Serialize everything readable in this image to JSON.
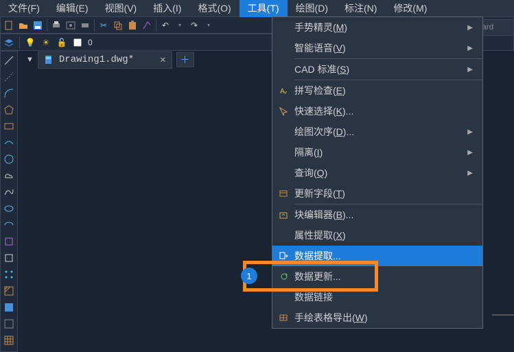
{
  "menubar": [
    {
      "label": "文件(F)",
      "active": false
    },
    {
      "label": "编辑(E)",
      "active": false
    },
    {
      "label": "视图(V)",
      "active": false
    },
    {
      "label": "插入(I)",
      "active": false
    },
    {
      "label": "格式(O)",
      "active": false
    },
    {
      "label": "工具(T)",
      "active": true
    },
    {
      "label": "绘图(D)",
      "active": false
    },
    {
      "label": "标注(N)",
      "active": false
    },
    {
      "label": "修改(M)",
      "active": false
    }
  ],
  "toolbar2": {
    "value": "0"
  },
  "tab": {
    "filename": "Drawing1.dwg*"
  },
  "rightFrag": "ard",
  "badge": "1",
  "dropdown": [
    {
      "label": "手势精灵",
      "key": "M",
      "submenu": true,
      "sep": false
    },
    {
      "label": "智能语音",
      "key": "V",
      "submenu": true,
      "sep": true
    },
    {
      "label": "CAD 标准",
      "key": "S",
      "submenu": true,
      "sep": true
    },
    {
      "label": "拼写检查",
      "key": "E",
      "icon": "spell",
      "sep": false
    },
    {
      "label": "快速选择",
      "key": "K",
      "ellipsis": true,
      "icon": "qselect",
      "sep": false
    },
    {
      "label": "绘图次序",
      "key": "D",
      "ellipsis": true,
      "submenu": true,
      "sep": false
    },
    {
      "label": "隔离",
      "key": "I",
      "submenu": true,
      "sep": false
    },
    {
      "label": "查询",
      "key": "Q",
      "submenu": true,
      "sep": false
    },
    {
      "label": "更新字段",
      "key": "T",
      "icon": "field",
      "sep": true
    },
    {
      "label": "块编辑器",
      "key": "B",
      "ellipsis": true,
      "icon": "block",
      "sep": false
    },
    {
      "label": "属性提取",
      "key": "X",
      "sep": false
    },
    {
      "label": "数据提取",
      "key": "",
      "ellipsis": true,
      "icon": "extract",
      "highlighted": true,
      "sep": false
    },
    {
      "label": "数据更新",
      "key": "",
      "ellipsis": true,
      "icon": "refresh",
      "sep": false
    },
    {
      "label": "数据链接",
      "key": "",
      "sep": false
    },
    {
      "label": "手绘表格导出",
      "key": "W",
      "icon": "table",
      "sep": false
    }
  ]
}
